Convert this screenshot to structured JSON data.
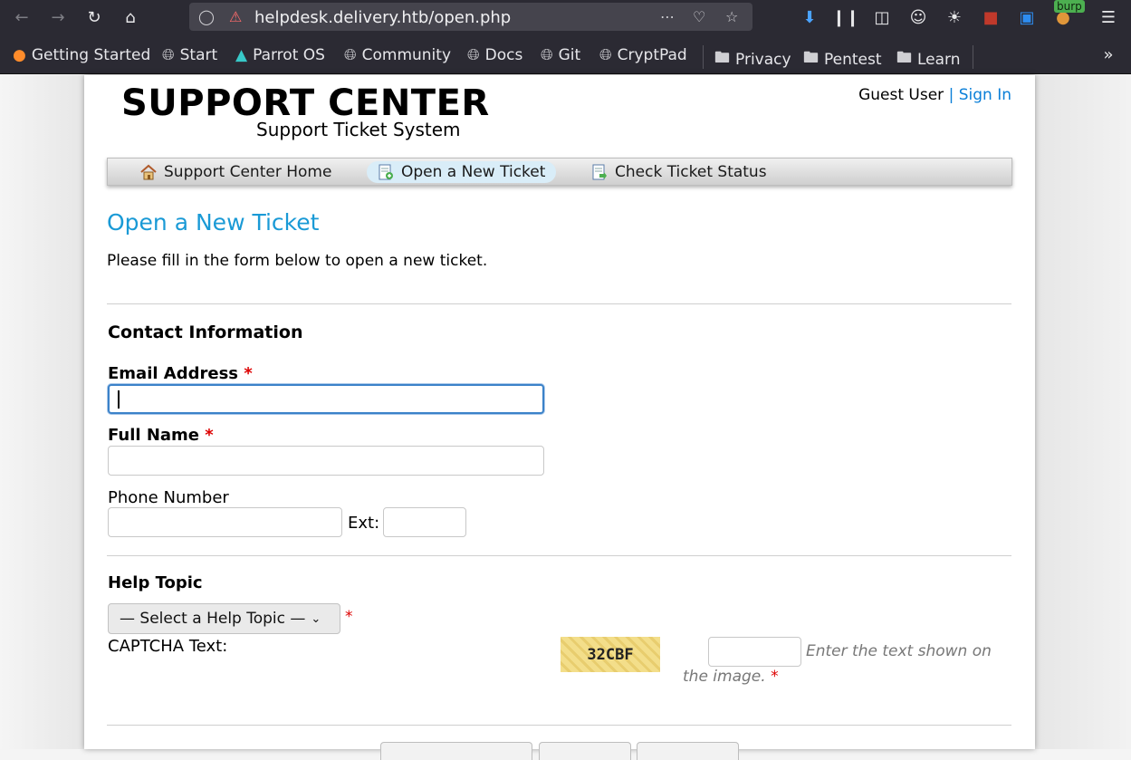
{
  "browser": {
    "url": "helpdesk.delivery.htb/open.php",
    "burp_badge": "burp",
    "bookmarks": [
      {
        "label": "Getting Started",
        "icon": "firefox-icon"
      },
      {
        "label": "Start",
        "icon": "globe-icon"
      },
      {
        "label": "Parrot OS",
        "icon": "parrot-icon"
      },
      {
        "label": "Community",
        "icon": "globe-icon"
      },
      {
        "label": "Docs",
        "icon": "globe-icon"
      },
      {
        "label": "Git",
        "icon": "globe-icon"
      },
      {
        "label": "CryptPad",
        "icon": "globe-icon"
      },
      {
        "label": "Privacy",
        "icon": "folder-icon"
      },
      {
        "label": "Pentest",
        "icon": "folder-icon"
      },
      {
        "label": "Learn",
        "icon": "folder-icon"
      }
    ]
  },
  "header": {
    "logo_main": "SUPPORT CENTER",
    "logo_sub": "Support Ticket System",
    "guest_label": "Guest User",
    "separator": "|",
    "sign_in": "Sign In"
  },
  "nav": {
    "items": [
      {
        "label": "Support Center Home",
        "icon": "home-icon"
      },
      {
        "label": "Open a New Ticket",
        "icon": "new-ticket-icon",
        "active": true
      },
      {
        "label": "Check Ticket Status",
        "icon": "ticket-status-icon"
      }
    ]
  },
  "main": {
    "title": "Open a New Ticket",
    "intro": "Please fill in the form below to open a new ticket.",
    "contact_heading": "Contact Information",
    "email_label": "Email Address",
    "name_label": "Full Name",
    "phone_label": "Phone Number",
    "ext_label": "Ext:",
    "required_mark": "*",
    "help_topic_heading": "Help Topic",
    "help_topic_selected": "— Select a Help Topic —",
    "captcha_label": "CAPTCHA Text:",
    "captcha_code": "32CBF",
    "captcha_hint_1": "Enter the text shown on",
    "captcha_hint_2": "the image."
  },
  "colors": {
    "accent": "#1a9ad6",
    "link": "#0a7fd8",
    "required": "#dd0000"
  }
}
